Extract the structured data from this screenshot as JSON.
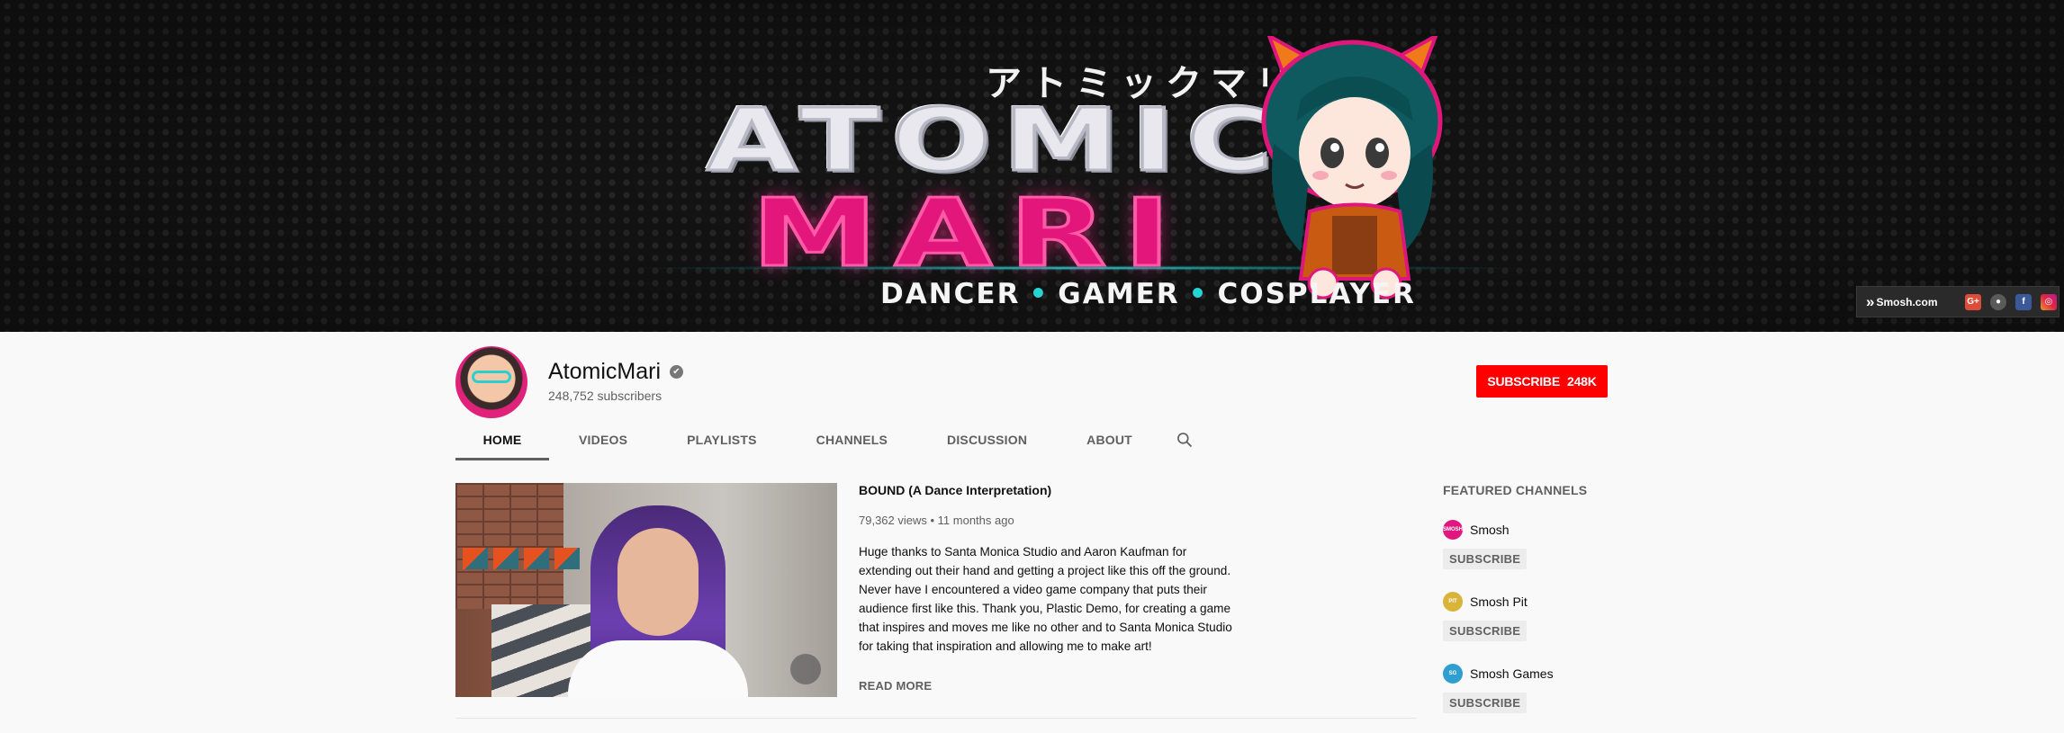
{
  "banner": {
    "japanese_title": "アトミックマリ",
    "logo_top": "ATOMIC",
    "logo_bottom": "MARI",
    "tagline": [
      "DANCER",
      "GAMER",
      "COSPLAYER"
    ],
    "tagline_separator": "•",
    "links": {
      "site_label": "Smosh.com",
      "icons": [
        "google-plus-icon",
        "globe-icon",
        "facebook-icon",
        "instagram-icon"
      ]
    }
  },
  "channel": {
    "name": "AtomicMari",
    "verified_glyph": "✔",
    "subscribers": "248,752 subscribers",
    "subscribe_label": "SUBSCRIBE",
    "subscribe_count": "248K"
  },
  "tabs": [
    {
      "label": "HOME",
      "active": true
    },
    {
      "label": "VIDEOS",
      "active": false
    },
    {
      "label": "PLAYLISTS",
      "active": false
    },
    {
      "label": "CHANNELS",
      "active": false
    },
    {
      "label": "DISCUSSION",
      "active": false
    },
    {
      "label": "ABOUT",
      "active": false
    }
  ],
  "featured_video": {
    "title": "BOUND (A Dance Interpretation)",
    "meta": "79,362 views • 11 months ago",
    "description": "Huge thanks to Santa Monica Studio and Aaron Kaufman for extending out their hand and getting a project like this off the ground. Never have I encountered a video game company that puts their audience first like this. Thank you, Plastic Demo, for creating a game that inspires and moves me like no other and to Santa Monica Studio for taking that inspiration and allowing me to make art!",
    "read_more": "READ MORE"
  },
  "featured_channels": {
    "heading": "FEATURED CHANNELS",
    "subscribe_label": "SUBSCRIBE",
    "items": [
      {
        "name": "Smosh",
        "icon_color": "#e0177f"
      },
      {
        "name": "Smosh Pit",
        "icon_color": "#d9b43a"
      },
      {
        "name": "Smosh Games",
        "icon_color": "#2f9fd0"
      }
    ]
  },
  "colors": {
    "brand_red": "#ff0000",
    "banner_pink": "#e3177b",
    "banner_cyan": "#27d4d4"
  }
}
